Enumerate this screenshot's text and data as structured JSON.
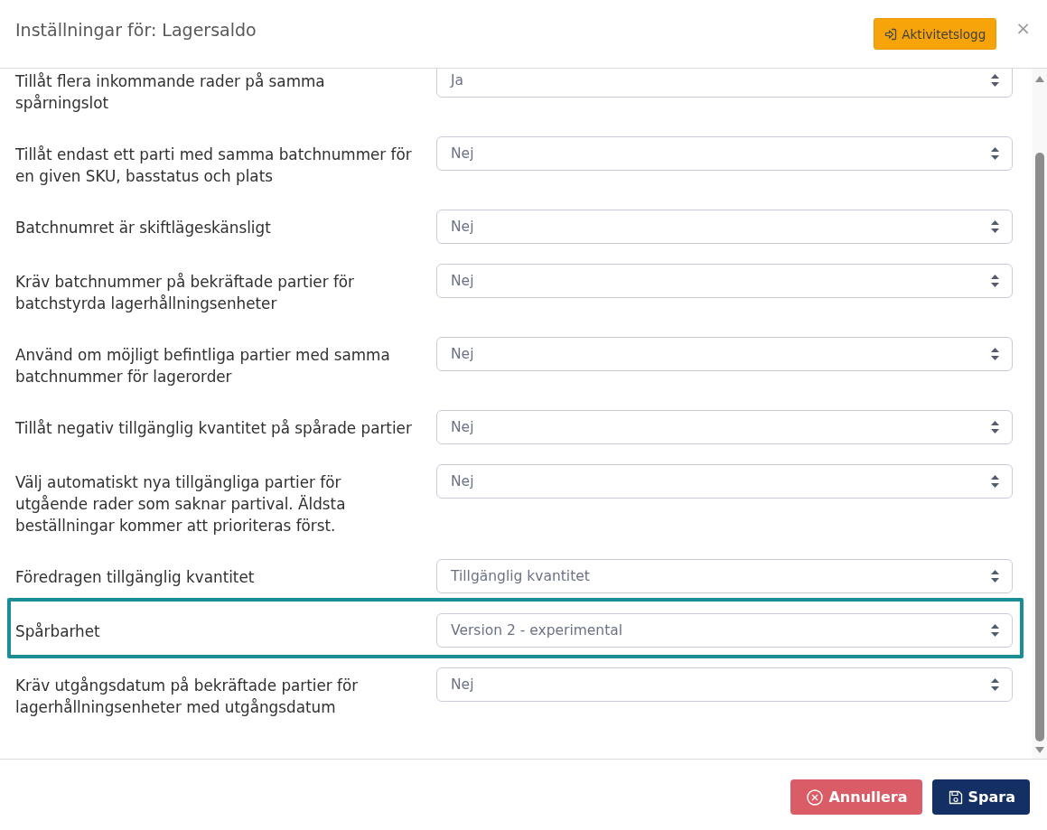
{
  "dialog": {
    "title": "Inställningar för: Lagersaldo",
    "activity_log_button": "Aktivitetslogg",
    "close": "×"
  },
  "settings": [
    {
      "label": "Tillåt flera inkommande rader på samma spårningslot",
      "value": "Ja",
      "highlighted": false
    },
    {
      "label": "Tillåt endast ett parti med samma batchnummer för en given SKU, basstatus och plats",
      "value": "Nej",
      "highlighted": false
    },
    {
      "label": "Batchnumret är skiftlägeskänsligt",
      "value": "Nej",
      "highlighted": false
    },
    {
      "label": "Kräv batchnummer på bekräftade partier för batchstyrda lagerhållningsenheter",
      "value": "Nej",
      "highlighted": false
    },
    {
      "label": "Använd om möjligt befintliga partier med samma batchnummer för lagerorder",
      "value": "Nej",
      "highlighted": false
    },
    {
      "label": "Tillåt negativ tillgänglig kvantitet på spårade partier",
      "value": "Nej",
      "highlighted": false
    },
    {
      "label": "Välj automatiskt nya tillgängliga partier för utgående rader som saknar partival. Äldsta beställningar kommer att prioriteras först.",
      "value": "Nej",
      "highlighted": false
    },
    {
      "label": "Föredragen tillgänglig kvantitet",
      "value": "Tillgänglig kvantitet",
      "highlighted": false
    },
    {
      "label": "Spårbarhet",
      "value": "Version 2 - experimental",
      "highlighted": true
    },
    {
      "label": "Kräv utgångsdatum på bekräftade partier för lagerhållningsenheter med utgångsdatum",
      "value": "Nej",
      "highlighted": false
    }
  ],
  "footer": {
    "buttons": [
      {
        "label": "Annullera",
        "kind": "cancel"
      },
      {
        "label": "Spara",
        "kind": "save"
      }
    ]
  }
}
